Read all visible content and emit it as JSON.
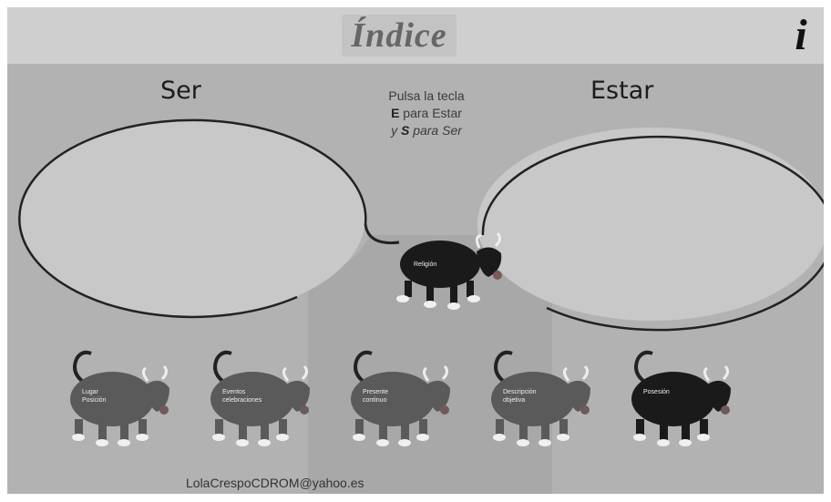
{
  "header": {
    "index_label": "Índice",
    "info_label": "i"
  },
  "bins": {
    "ser_label": "Ser",
    "estar_label": "Estar"
  },
  "instructions": {
    "line1": "Pulsa la tecla",
    "key_e": "E",
    "line2_rest": " para Estar",
    "line3_prefix": "y ",
    "key_s": "S",
    "line3_rest": " para Ser"
  },
  "active_card": {
    "label": "Religión"
  },
  "cards": [
    {
      "line1": "Lugar",
      "line2": "Posición"
    },
    {
      "line1": "Eventos",
      "line2": "celebraciones"
    },
    {
      "line1": "Presente",
      "line2": "continuo"
    },
    {
      "line1": "Descripción",
      "line2": "objetiva"
    },
    {
      "line1": "Posesión",
      "line2": ""
    }
  ],
  "footer": {
    "email": "LolaCrespoCDROM@yahoo.es"
  },
  "colors": {
    "background": "#b2b2b2",
    "header": "#cfcfcf",
    "bin_fill": "#c8c8c8",
    "bull_body": "#5a5a5a",
    "bull_dark": "#1a1a1a"
  }
}
